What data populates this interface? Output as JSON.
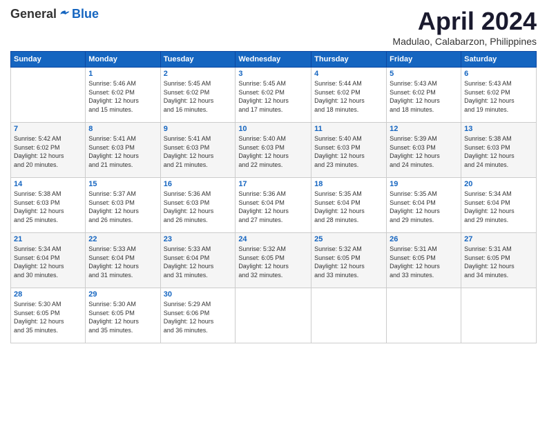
{
  "logo": {
    "general": "General",
    "blue": "Blue"
  },
  "title": "April 2024",
  "location": "Madulao, Calabarzon, Philippines",
  "days_header": [
    "Sunday",
    "Monday",
    "Tuesday",
    "Wednesday",
    "Thursday",
    "Friday",
    "Saturday"
  ],
  "weeks": [
    [
      {
        "day": "",
        "info": ""
      },
      {
        "day": "1",
        "info": "Sunrise: 5:46 AM\nSunset: 6:02 PM\nDaylight: 12 hours\nand 15 minutes."
      },
      {
        "day": "2",
        "info": "Sunrise: 5:45 AM\nSunset: 6:02 PM\nDaylight: 12 hours\nand 16 minutes."
      },
      {
        "day": "3",
        "info": "Sunrise: 5:45 AM\nSunset: 6:02 PM\nDaylight: 12 hours\nand 17 minutes."
      },
      {
        "day": "4",
        "info": "Sunrise: 5:44 AM\nSunset: 6:02 PM\nDaylight: 12 hours\nand 18 minutes."
      },
      {
        "day": "5",
        "info": "Sunrise: 5:43 AM\nSunset: 6:02 PM\nDaylight: 12 hours\nand 18 minutes."
      },
      {
        "day": "6",
        "info": "Sunrise: 5:43 AM\nSunset: 6:02 PM\nDaylight: 12 hours\nand 19 minutes."
      }
    ],
    [
      {
        "day": "7",
        "info": "Sunrise: 5:42 AM\nSunset: 6:02 PM\nDaylight: 12 hours\nand 20 minutes."
      },
      {
        "day": "8",
        "info": "Sunrise: 5:41 AM\nSunset: 6:03 PM\nDaylight: 12 hours\nand 21 minutes."
      },
      {
        "day": "9",
        "info": "Sunrise: 5:41 AM\nSunset: 6:03 PM\nDaylight: 12 hours\nand 21 minutes."
      },
      {
        "day": "10",
        "info": "Sunrise: 5:40 AM\nSunset: 6:03 PM\nDaylight: 12 hours\nand 22 minutes."
      },
      {
        "day": "11",
        "info": "Sunrise: 5:40 AM\nSunset: 6:03 PM\nDaylight: 12 hours\nand 23 minutes."
      },
      {
        "day": "12",
        "info": "Sunrise: 5:39 AM\nSunset: 6:03 PM\nDaylight: 12 hours\nand 24 minutes."
      },
      {
        "day": "13",
        "info": "Sunrise: 5:38 AM\nSunset: 6:03 PM\nDaylight: 12 hours\nand 24 minutes."
      }
    ],
    [
      {
        "day": "14",
        "info": "Sunrise: 5:38 AM\nSunset: 6:03 PM\nDaylight: 12 hours\nand 25 minutes."
      },
      {
        "day": "15",
        "info": "Sunrise: 5:37 AM\nSunset: 6:03 PM\nDaylight: 12 hours\nand 26 minutes."
      },
      {
        "day": "16",
        "info": "Sunrise: 5:36 AM\nSunset: 6:03 PM\nDaylight: 12 hours\nand 26 minutes."
      },
      {
        "day": "17",
        "info": "Sunrise: 5:36 AM\nSunset: 6:04 PM\nDaylight: 12 hours\nand 27 minutes."
      },
      {
        "day": "18",
        "info": "Sunrise: 5:35 AM\nSunset: 6:04 PM\nDaylight: 12 hours\nand 28 minutes."
      },
      {
        "day": "19",
        "info": "Sunrise: 5:35 AM\nSunset: 6:04 PM\nDaylight: 12 hours\nand 29 minutes."
      },
      {
        "day": "20",
        "info": "Sunrise: 5:34 AM\nSunset: 6:04 PM\nDaylight: 12 hours\nand 29 minutes."
      }
    ],
    [
      {
        "day": "21",
        "info": "Sunrise: 5:34 AM\nSunset: 6:04 PM\nDaylight: 12 hours\nand 30 minutes."
      },
      {
        "day": "22",
        "info": "Sunrise: 5:33 AM\nSunset: 6:04 PM\nDaylight: 12 hours\nand 31 minutes."
      },
      {
        "day": "23",
        "info": "Sunrise: 5:33 AM\nSunset: 6:04 PM\nDaylight: 12 hours\nand 31 minutes."
      },
      {
        "day": "24",
        "info": "Sunrise: 5:32 AM\nSunset: 6:05 PM\nDaylight: 12 hours\nand 32 minutes."
      },
      {
        "day": "25",
        "info": "Sunrise: 5:32 AM\nSunset: 6:05 PM\nDaylight: 12 hours\nand 33 minutes."
      },
      {
        "day": "26",
        "info": "Sunrise: 5:31 AM\nSunset: 6:05 PM\nDaylight: 12 hours\nand 33 minutes."
      },
      {
        "day": "27",
        "info": "Sunrise: 5:31 AM\nSunset: 6:05 PM\nDaylight: 12 hours\nand 34 minutes."
      }
    ],
    [
      {
        "day": "28",
        "info": "Sunrise: 5:30 AM\nSunset: 6:05 PM\nDaylight: 12 hours\nand 35 minutes."
      },
      {
        "day": "29",
        "info": "Sunrise: 5:30 AM\nSunset: 6:05 PM\nDaylight: 12 hours\nand 35 minutes."
      },
      {
        "day": "30",
        "info": "Sunrise: 5:29 AM\nSunset: 6:06 PM\nDaylight: 12 hours\nand 36 minutes."
      },
      {
        "day": "",
        "info": ""
      },
      {
        "day": "",
        "info": ""
      },
      {
        "day": "",
        "info": ""
      },
      {
        "day": "",
        "info": ""
      }
    ]
  ]
}
